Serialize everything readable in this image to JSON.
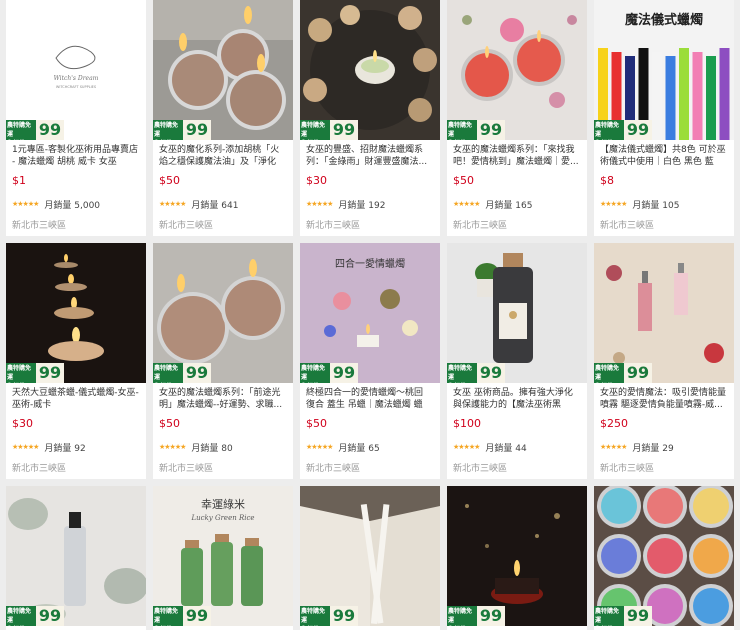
{
  "badge": {
    "line1": "農特購免運",
    "line2": "免領券",
    "num": "99",
    "unit": "起"
  },
  "rows": [
    [
      {
        "title": "1元專區-客製化巫術用品專賣店 - 魔法蠟燭 胡桃 威卡 女巫",
        "price": "$1",
        "stars": "★★★★★",
        "sales": "月銷量 5,000",
        "loc": "新北市三峽區",
        "img": "logo",
        "logo_text": "Witch's Dream",
        "logo_sub": "WITCHCRAFT SUPPLIES"
      },
      {
        "title": "女巫的魔化系列-添加胡桃「火焰之穩保護魔法油」及「淨化神...",
        "price": "$50",
        "stars": "★★★★★",
        "sales": "月銷量 641",
        "loc": "新北市三峽區",
        "img": "tea3"
      },
      {
        "title": "女巫的豐盛、招財魔法蠟燭系列：「金綠雨」財運豐盛魔法...",
        "price": "$30",
        "stars": "★★★★★",
        "sales": "月銷量 192",
        "loc": "新北市三峽區",
        "img": "crystals"
      },
      {
        "title": "女巫的魔法蠟燭系列：「來找我吧！愛情桃到」魔法蠟燭｜愛...",
        "price": "$50",
        "stars": "★★★★★",
        "sales": "月銷量 165",
        "loc": "新北市三峽區",
        "img": "rose"
      },
      {
        "title": "【魔法儀式蠟燭】共8色 可於巫術儀式中使用｜白色 黑色 藍色...",
        "price": "$8",
        "stars": "★★★★★",
        "sales": "月銷量 105",
        "loc": "新北市三峽區",
        "img": "tapers",
        "caption": "魔法儀式蠟燭"
      }
    ],
    [
      {
        "title": "天然大豆蠟茶蠟-儀式蠟燭-女巫-巫術-威卡",
        "price": "$30",
        "stars": "★★★★★",
        "sales": "月銷量 92",
        "loc": "新北市三峽區",
        "img": "dark"
      },
      {
        "title": "女巫的魔法蠟燭系列：「前途光明」魔法蠟燭--好運勢、求職...",
        "price": "$50",
        "stars": "★★★★★",
        "sales": "月銷量 80",
        "loc": "新北市三峽區",
        "img": "tea2"
      },
      {
        "title": "終極四合一的愛情蠟燭～桃回 復合 蓋生 吊蠟｜魔法蠟燭 蠟燭...",
        "price": "$50",
        "stars": "★★★★★",
        "sales": "月銷量 65",
        "loc": "新北市三峽區",
        "img": "lilac",
        "caption": "四合一愛情蠟燭"
      },
      {
        "title": "女巫 巫術商品。擁有強大淨化與保護能力的【魔法巫術黑鹽】...",
        "price": "$100",
        "stars": "★★★★★",
        "sales": "月銷量 44",
        "loc": "新北市三峽區",
        "img": "bottle"
      },
      {
        "title": "女巫的愛情魔法：吸引愛情能量噴霧 驅逐愛情負能量噴霧-威...",
        "price": "$250",
        "stars": "★★★★★",
        "sales": "月銷量 29",
        "loc": "新北市三峽區",
        "img": "book"
      }
    ],
    [
      {
        "img": "sage"
      },
      {
        "img": "green",
        "caption": "幸運綠米",
        "caption2": "Lucky Green Rice"
      },
      {
        "img": "open"
      },
      {
        "img": "night"
      },
      {
        "img": "tins"
      }
    ]
  ]
}
